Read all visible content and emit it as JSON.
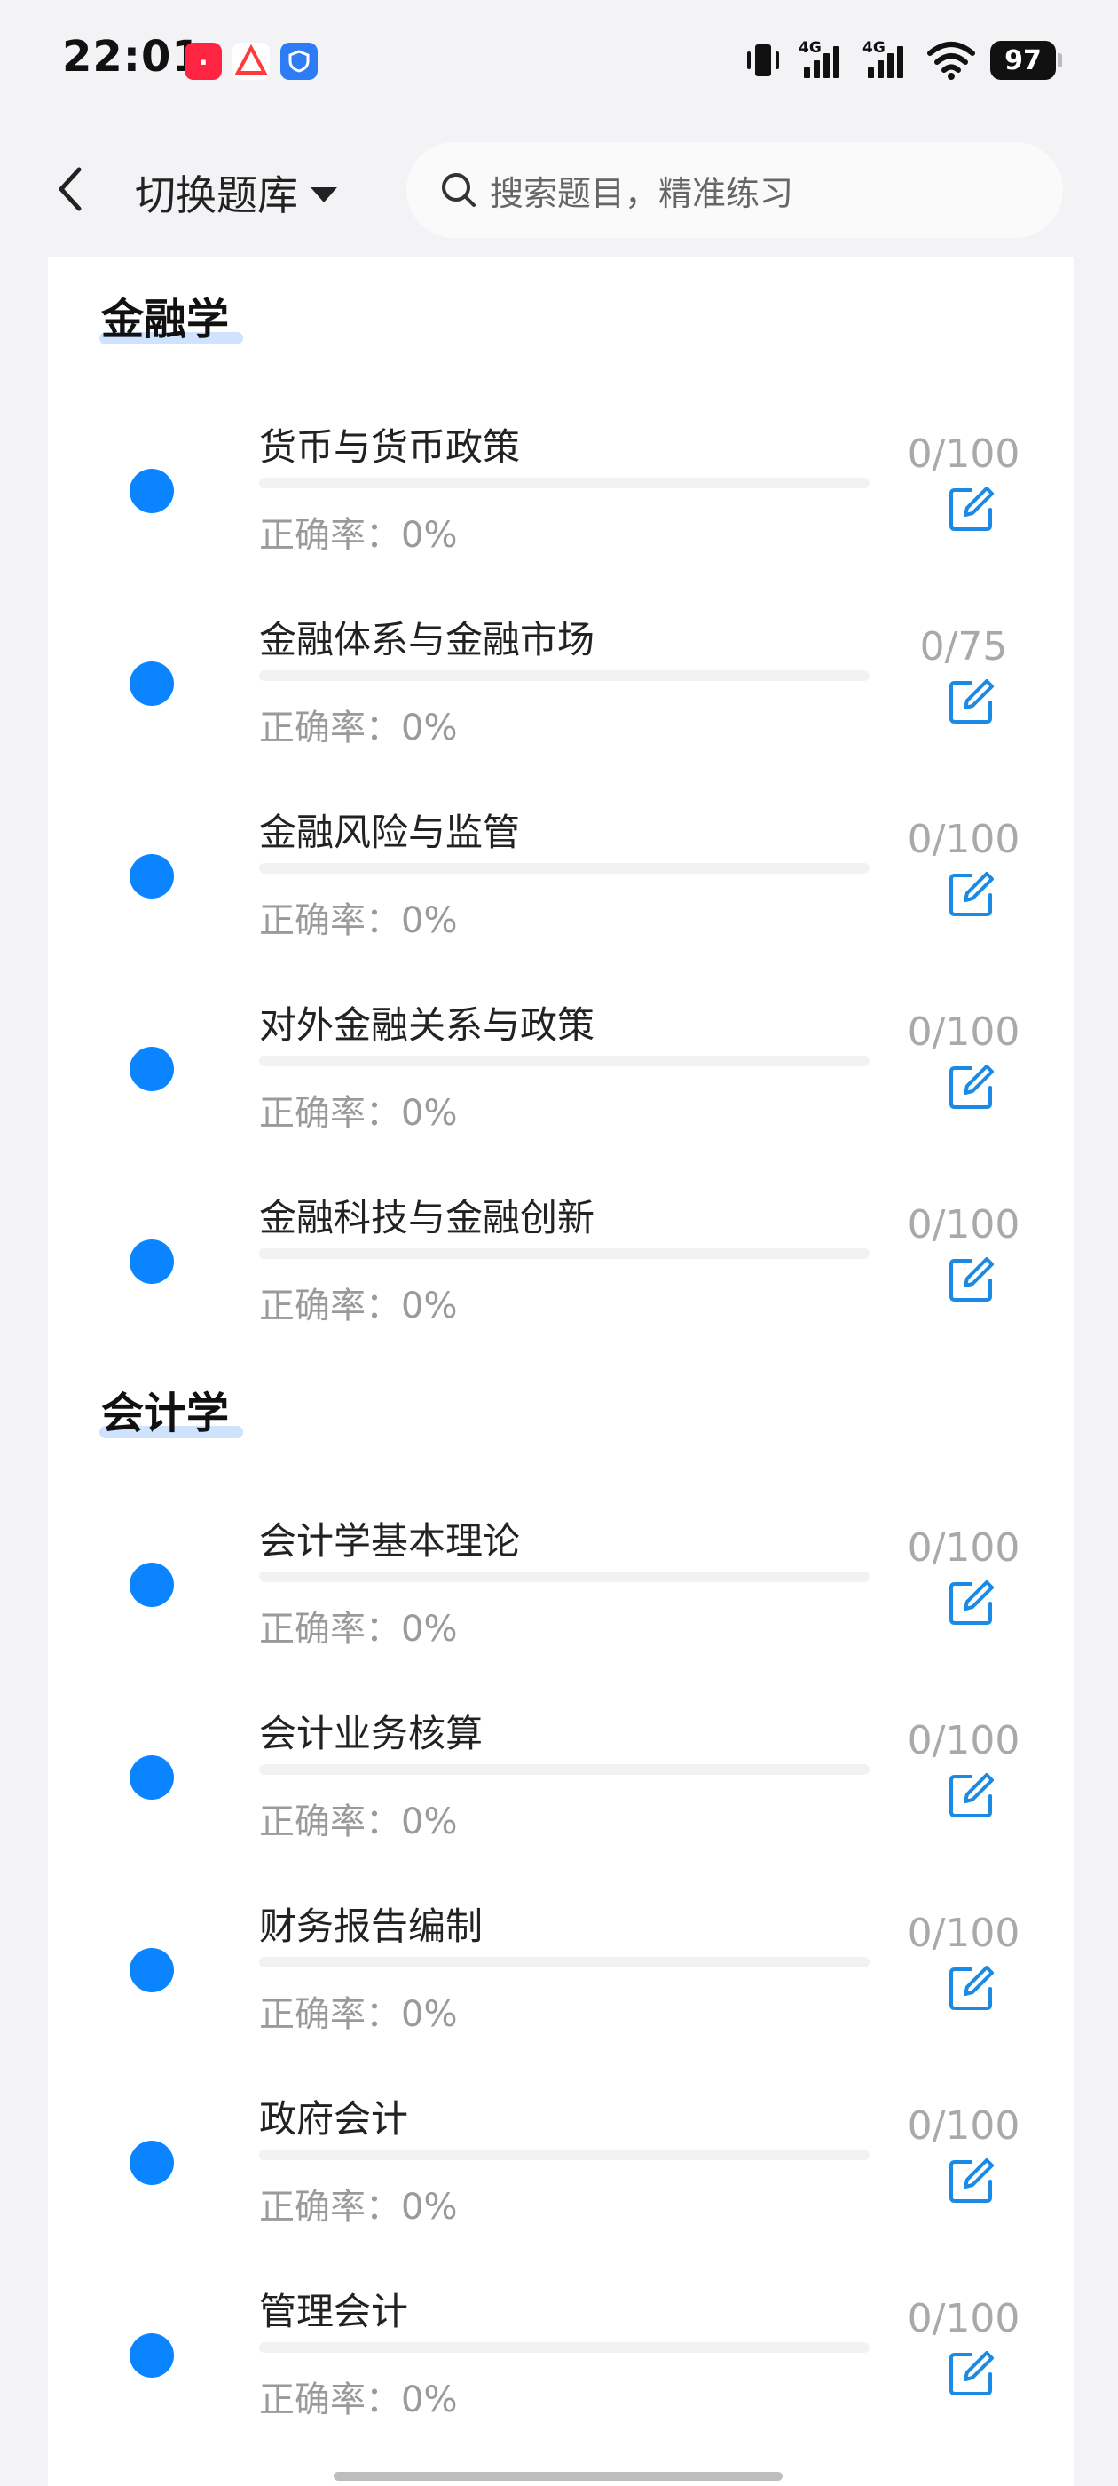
{
  "status_bar": {
    "time": "22:01",
    "network1": "4G",
    "network2": "4G",
    "battery": "97",
    "icons": [
      "xiaohongshu-app-icon",
      "triangle-app-icon",
      "shield-app-icon",
      "vibrate-icon",
      "signal-icon",
      "wifi-icon",
      "battery-icon"
    ]
  },
  "header": {
    "switch_label": "切换题库",
    "search_placeholder": "搜索题目，精准练习"
  },
  "sections": [
    {
      "title": "金融学",
      "items": [
        {
          "title": "货币与货币政策",
          "accuracy": "正确率：0%",
          "count": "0/100",
          "progress": 0
        },
        {
          "title": "金融体系与金融市场",
          "accuracy": "正确率：0%",
          "count": "0/75",
          "progress": 0
        },
        {
          "title": "金融风险与监管",
          "accuracy": "正确率：0%",
          "count": "0/100",
          "progress": 0
        },
        {
          "title": "对外金融关系与政策",
          "accuracy": "正确率：0%",
          "count": "0/100",
          "progress": 0
        },
        {
          "title": "金融科技与金融创新",
          "accuracy": "正确率：0%",
          "count": "0/100",
          "progress": 0
        }
      ]
    },
    {
      "title": "会计学",
      "items": [
        {
          "title": "会计学基本理论",
          "accuracy": "正确率：0%",
          "count": "0/100",
          "progress": 0
        },
        {
          "title": "会计业务核算",
          "accuracy": "正确率：0%",
          "count": "0/100",
          "progress": 0
        },
        {
          "title": "财务报告编制",
          "accuracy": "正确率：0%",
          "count": "0/100",
          "progress": 0
        },
        {
          "title": "政府会计",
          "accuracy": "正确率：0%",
          "count": "0/100",
          "progress": 0
        },
        {
          "title": "管理会计",
          "accuracy": "正确率：0%",
          "count": "0/100",
          "progress": 0
        }
      ]
    }
  ],
  "colors": {
    "accent": "#0a84ff",
    "edit_icon": "#1a8ae5",
    "muted_text": "#9a9a9a"
  }
}
